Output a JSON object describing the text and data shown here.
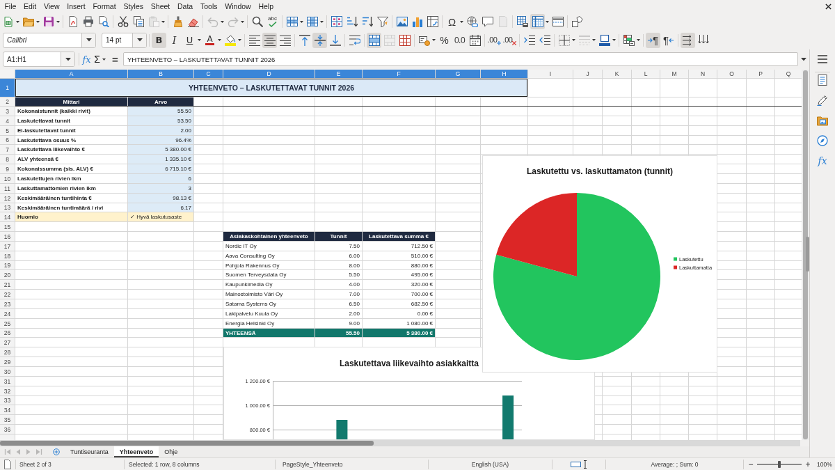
{
  "menu_bar": [
    "File",
    "Edit",
    "View",
    "Insert",
    "Format",
    "Styles",
    "Sheet",
    "Data",
    "Tools",
    "Window",
    "Help"
  ],
  "standard_toolbar": [
    [
      {
        "pressed": false,
        "disabled": false,
        "dropdown": true
      },
      {
        "pressed": false,
        "disabled": false,
        "dropdown": true
      },
      {
        "pressed": false,
        "disabled": false,
        "dropdown": true
      }
    ],
    [
      {
        "pressed": false,
        "disabled": false,
        "dropdown": false
      },
      {
        "pressed": false,
        "disabled": false,
        "dropdown": false
      },
      {
        "pressed": false,
        "disabled": false,
        "dropdown": false
      }
    ],
    [
      {
        "pressed": false,
        "disabled": false,
        "dropdown": false
      },
      {
        "pressed": false,
        "disabled": false,
        "dropdown": false
      },
      {
        "pressed": false,
        "disabled": true,
        "dropdown": true
      }
    ],
    [
      {
        "pressed": false,
        "disabled": false,
        "dropdown": false
      },
      {
        "pressed": false,
        "disabled": false,
        "dropdown": false
      }
    ],
    [
      {
        "pressed": false,
        "disabled": true,
        "dropdown": true
      },
      {
        "pressed": false,
        "disabled": true,
        "dropdown": true
      }
    ],
    [
      {
        "pressed": false,
        "disabled": false,
        "dropdown": false
      },
      {
        "glyph": "abc",
        "pressed": false,
        "disabled": false,
        "dropdown": false
      }
    ],
    [
      {
        "pressed": false,
        "disabled": false,
        "dropdown": true
      },
      {
        "pressed": false,
        "disabled": false,
        "dropdown": true
      }
    ],
    [
      {
        "pressed": false,
        "disabled": false,
        "dropdown": false
      },
      {
        "pressed": false,
        "disabled": false,
        "dropdown": false
      },
      {
        "pressed": false,
        "disabled": false,
        "dropdown": false
      },
      {
        "pressed": false,
        "disabled": false,
        "dropdown": false
      }
    ],
    [
      {
        "pressed": false,
        "disabled": false,
        "dropdown": false
      },
      {
        "pressed": false,
        "disabled": false,
        "dropdown": false
      },
      {
        "pressed": false,
        "disabled": false,
        "dropdown": false
      }
    ],
    [
      {
        "glyph": "Ω",
        "pressed": false,
        "disabled": false,
        "dropdown": true
      },
      {
        "pressed": false,
        "disabled": false,
        "dropdown": false
      },
      {
        "pressed": false,
        "disabled": false,
        "dropdown": false
      },
      {
        "pressed": false,
        "disabled": true,
        "dropdown": false
      }
    ],
    [
      {
        "pressed": false,
        "disabled": false,
        "dropdown": false
      },
      {
        "pressed": true,
        "disabled": false,
        "dropdown": true
      },
      {
        "pressed": false,
        "disabled": false,
        "dropdown": false
      }
    ],
    [
      {
        "pressed": false,
        "disabled": false,
        "dropdown": false
      }
    ]
  ],
  "formatting_toolbar": {
    "font_name": "Calibri",
    "font_size": "14 pt",
    "groups": [
      [
        {
          "glyph": "B",
          "pressed": true,
          "disabled": false,
          "dropdown": false
        },
        {
          "glyph": "I",
          "pressed": false,
          "disabled": false,
          "dropdown": false
        },
        {
          "glyph": "U",
          "pressed": false,
          "disabled": false,
          "dropdown": true
        },
        {
          "glyph": "A",
          "pressed": false,
          "disabled": false,
          "dropdown": true
        },
        {
          "pressed": false,
          "disabled": false,
          "dropdown": true
        }
      ],
      [
        {
          "pressed": false,
          "disabled": false,
          "dropdown": false
        },
        {
          "pressed": true,
          "disabled": false,
          "dropdown": false
        },
        {
          "pressed": false,
          "disabled": false,
          "dropdown": false
        }
      ],
      [
        {
          "pressed": false,
          "disabled": false,
          "dropdown": false
        },
        {
          "pressed": true,
          "disabled": false,
          "dropdown": false
        },
        {
          "pressed": false,
          "disabled": false,
          "dropdown": false
        }
      ],
      [
        {
          "pressed": false,
          "disabled": false,
          "dropdown": false
        }
      ],
      [
        {
          "pressed": true,
          "disabled": false,
          "dropdown": false
        },
        {
          "pressed": false,
          "disabled": true,
          "dropdown": false
        },
        {
          "pressed": false,
          "disabled": false,
          "dropdown": false
        }
      ],
      [
        {
          "pressed": false,
          "disabled": false,
          "dropdown": true
        },
        {
          "glyph": "%",
          "pressed": false,
          "disabled": false,
          "dropdown": false
        },
        {
          "glyph": "0.0",
          "pressed": false,
          "disabled": false,
          "dropdown": false
        },
        {
          "pressed": false,
          "disabled": false,
          "dropdown": false
        }
      ],
      [
        {
          "glyph": ".00",
          "pressed": false,
          "disabled": false,
          "dropdown": false
        },
        {
          "glyph": ".00",
          "pressed": false,
          "disabled": false,
          "dropdown": false
        }
      ],
      [
        {
          "pressed": false,
          "disabled": false,
          "dropdown": false
        },
        {
          "pressed": false,
          "disabled": false,
          "dropdown": false
        }
      ],
      [
        {
          "pressed": false,
          "disabled": false,
          "dropdown": true
        },
        {
          "pressed": false,
          "disabled": true,
          "dropdown": true
        },
        {
          "pressed": false,
          "disabled": false,
          "dropdown": true
        }
      ],
      [
        {
          "pressed": false,
          "disabled": false,
          "dropdown": true
        }
      ],
      [
        {
          "glyph": "¶",
          "pressed": true,
          "disabled": false,
          "dropdown": false
        },
        {
          "glyph": "¶",
          "pressed": false,
          "disabled": false,
          "dropdown": false
        }
      ],
      [
        {
          "pressed": true,
          "disabled": false,
          "dropdown": false
        },
        {
          "pressed": false,
          "disabled": false,
          "dropdown": false
        }
      ]
    ]
  },
  "formula_bar": {
    "name_box": "A1:H1",
    "buttons": [
      {
        "glyph": "fx",
        "dropdown": false
      },
      {
        "glyph": "Σ",
        "dropdown": true
      },
      {
        "glyph": "=",
        "dropdown": false
      }
    ],
    "content": "YHTEENVETO – LASKUTETTAVAT TUNNIT 2026"
  },
  "sidebar": {
    "tabs": [
      {
        "selected": false
      },
      {
        "selected": false
      },
      {
        "selected": false
      },
      {
        "selected": false
      },
      {
        "glyph": "fx",
        "selected": false
      }
    ]
  },
  "sheet": {
    "column_headers": [
      {
        "label": "A",
        "selected": true
      },
      {
        "label": "B",
        "selected": true
      },
      {
        "label": "C",
        "selected": true
      },
      {
        "label": "D",
        "selected": true
      },
      {
        "label": "E",
        "selected": true
      },
      {
        "label": "F",
        "selected": true
      },
      {
        "label": "G",
        "selected": true
      },
      {
        "label": "H",
        "selected": true
      },
      {
        "label": "I",
        "selected": false
      },
      {
        "label": "J",
        "selected": false
      },
      {
        "label": "K",
        "selected": false
      },
      {
        "label": "L",
        "selected": false
      },
      {
        "label": "M",
        "selected": false
      },
      {
        "label": "N",
        "selected": false
      },
      {
        "label": "O",
        "selected": false
      },
      {
        "label": "P",
        "selected": false
      },
      {
        "label": "Q",
        "selected": false
      }
    ],
    "row_headers": [
      {
        "label": "1",
        "selected": true
      },
      {
        "label": "2",
        "selected": false
      },
      {
        "label": "3",
        "selected": false
      },
      {
        "label": "4",
        "selected": false
      },
      {
        "label": "5",
        "selected": false
      },
      {
        "label": "6",
        "selected": false
      },
      {
        "label": "7",
        "selected": false
      },
      {
        "label": "8",
        "selected": false
      },
      {
        "label": "9",
        "selected": false
      },
      {
        "label": "10",
        "selected": false
      },
      {
        "label": "11",
        "selected": false
      },
      {
        "label": "12",
        "selected": false
      },
      {
        "label": "13",
        "selected": false
      },
      {
        "label": "14",
        "selected": false
      },
      {
        "label": "15",
        "selected": false
      },
      {
        "label": "16",
        "selected": false
      },
      {
        "label": "17",
        "selected": false
      },
      {
        "label": "18",
        "selected": false
      },
      {
        "label": "19",
        "selected": false
      },
      {
        "label": "20",
        "selected": false
      },
      {
        "label": "21",
        "selected": false
      },
      {
        "label": "22",
        "selected": false
      },
      {
        "label": "23",
        "selected": false
      },
      {
        "label": "24",
        "selected": false
      },
      {
        "label": "25",
        "selected": false
      },
      {
        "label": "26",
        "selected": false
      },
      {
        "label": "27",
        "selected": false
      },
      {
        "label": "28",
        "selected": false
      },
      {
        "label": "29",
        "selected": false
      },
      {
        "label": "30",
        "selected": false
      },
      {
        "label": "31",
        "selected": false
      },
      {
        "label": "32",
        "selected": false
      },
      {
        "label": "33",
        "selected": false
      },
      {
        "label": "34",
        "selected": false
      },
      {
        "label": "35",
        "selected": false
      },
      {
        "label": "36",
        "selected": false
      }
    ],
    "title": {
      "text": "YHTEENVETO – LASKUTETTAVAT TUNNIT 2026",
      "selected": true
    },
    "summary_table": {
      "columns": [
        "Mittari",
        "Arvo"
      ],
      "rows": [
        {
          "metric": "Kokonaistunnit (kaikki rivit)",
          "value": "55.50"
        },
        {
          "metric": "Laskutettavat tunnit",
          "value": "53.50"
        },
        {
          "metric": "Ei-laskutettavat tunnit",
          "value": "2.00"
        },
        {
          "metric": "Laskutettava osuus %",
          "value": "96.4%"
        },
        {
          "metric": "Laskutettava liikevaihto €",
          "value": "5 380.00 €"
        },
        {
          "metric": "ALV yhteensä €",
          "value": "1 335.10 €"
        },
        {
          "metric": "Kokonaissumma (sis. ALV) €",
          "value": "6 715.10 €"
        },
        {
          "metric": "Laskutettujen rivien lkm",
          "value": "6"
        },
        {
          "metric": "Laskuttamattomien rivien lkm",
          "value": "3"
        },
        {
          "metric": "Keskimääräinen tuntihinta €",
          "value": "98.13 €"
        },
        {
          "metric": "Keskimääräinen tuntimäärä / rivi",
          "value": "6.17"
        }
      ],
      "note": {
        "label": "Huomio",
        "value": "✓ Hyvä laskutusaste"
      }
    },
    "customer_table": {
      "columns": [
        "Asiakaskohtainen yhteenveto",
        "Tunnit",
        "Laskutettava summa €"
      ],
      "rows": [
        {
          "customer": "Nordic IT Oy",
          "hours": "7.50",
          "amount": "712.50 €"
        },
        {
          "customer": "Aava Consulting Oy",
          "hours": "6.00",
          "amount": "510.00 €"
        },
        {
          "customer": "Pohjola Rakennus Oy",
          "hours": "8.00",
          "amount": "880.00 €"
        },
        {
          "customer": "Suomen Terveysdata Oy",
          "hours": "5.50",
          "amount": "495.00 €"
        },
        {
          "customer": "Kaupunkimedia Oy",
          "hours": "4.00",
          "amount": "320.00 €"
        },
        {
          "customer": "Mainostoimisto Väri Oy",
          "hours": "7.00",
          "amount": "700.00 €"
        },
        {
          "customer": "Satama Systems Oy",
          "hours": "6.50",
          "amount": "682.50 €"
        },
        {
          "customer": "Lakipalvelu Kuula Oy",
          "hours": "2.00",
          "amount": "0.00 €"
        },
        {
          "customer": "Energia Helsinki Oy",
          "hours": "9.00",
          "amount": "1 080.00 €"
        }
      ],
      "total": {
        "label": "YHTEENSÄ",
        "hours": "55.50",
        "amount": "5 380.00 €"
      }
    },
    "charts": [
      {
        "slices": [
          {
            "color": "#22c55e"
          },
          {
            "color": "#dc2626"
          }
        ],
        "chart_data": {
          "type": "pie",
          "title": "Laskutettu vs. laskuttamaton (tunnit)",
          "categories": [
            "Laskutettu",
            "Laskuttamatta"
          ],
          "values": [
            79.2,
            20.8
          ],
          "legend": "right"
        }
      },
      {
        "chart_data": {
          "type": "bar",
          "title": "Laskutettava liikevaihto asiakkaitta",
          "ylim": [
            720,
            1200
          ],
          "yticks": [
            {
              "value": 800,
              "label": "800.00 €"
            },
            {
              "value": 1000,
              "label": "1 000.00 €"
            },
            {
              "value": 1200,
              "label": "1 200.00 €"
            }
          ],
          "values": [
            null,
            null,
            880,
            null,
            null,
            null,
            null,
            null,
            1080
          ]
        }
      }
    ]
  },
  "sheet_tab_bar": {
    "navigation": [
      {
        "disabled": true
      },
      {
        "disabled": true
      },
      {
        "disabled": true
      },
      {
        "disabled": true
      }
    ],
    "tabs": [
      {
        "label": "Tuntiseuranta",
        "selected": false
      },
      {
        "label": "Yhteenveto",
        "selected": true
      },
      {
        "label": "Ohje",
        "selected": false
      }
    ]
  },
  "status_bar": {
    "sheet": "Sheet 2 of 3",
    "selection": "Selected: 1 row, 8 columns",
    "page_style": "PageStyle_Yhteenveto",
    "language": "English (USA)",
    "summary": "Average: ; Sum: 0",
    "zoom": {
      "minus": "−",
      "level": 0.5,
      "plus": "+",
      "reading": "100%"
    }
  }
}
